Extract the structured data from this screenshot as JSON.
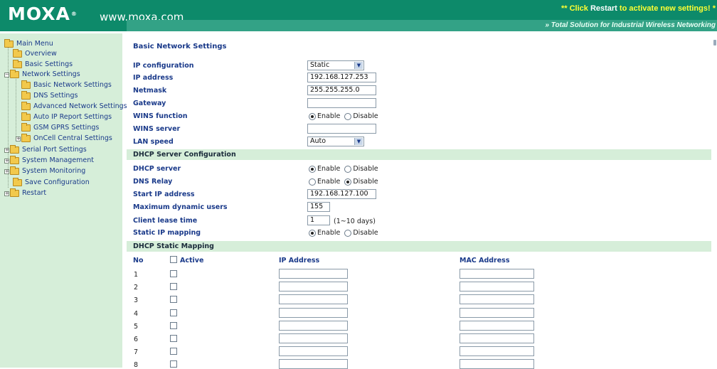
{
  "header": {
    "logo": "MOXA",
    "logo_mark": "®",
    "url": "www.moxa.com",
    "notice_prefix": "** Click ",
    "notice_bold": "Restart",
    "notice_suffix": " to activate new settings! *",
    "tagline": "» Total Solution for Industrial Wireless Networking",
    "bg_color": "#0d8a6a",
    "notice_color": "#ffff33"
  },
  "sidebar": {
    "items": [
      {
        "label": "Main Menu",
        "toggle": ""
      },
      {
        "label": "Overview",
        "toggle": ""
      },
      {
        "label": "Basic Settings",
        "toggle": ""
      },
      {
        "label": "Network Settings",
        "toggle": "−"
      },
      {
        "label": "Basic Network Settings",
        "toggle": ""
      },
      {
        "label": "DNS Settings",
        "toggle": ""
      },
      {
        "label": "Advanced Network Settings",
        "toggle": ""
      },
      {
        "label": "Auto IP Report Settings",
        "toggle": ""
      },
      {
        "label": "GSM GPRS Settings",
        "toggle": ""
      },
      {
        "label": "OnCell Central Settings",
        "toggle": "+"
      },
      {
        "label": "Serial Port Settings",
        "toggle": "+"
      },
      {
        "label": "System Management",
        "toggle": "+"
      },
      {
        "label": "System Monitoring",
        "toggle": "+"
      },
      {
        "label": "Save Configuration",
        "toggle": ""
      },
      {
        "label": "Restart",
        "toggle": "+"
      }
    ],
    "bg_color": "#d6eed9"
  },
  "page": {
    "title": "Basic Network Settings"
  },
  "basic": {
    "ip_config_label": "IP configuration",
    "ip_config_value": "Static",
    "ip_address_label": "IP address",
    "ip_address_value": "192.168.127.253",
    "netmask_label": "Netmask",
    "netmask_value": "255.255.255.0",
    "gateway_label": "Gateway",
    "gateway_value": "",
    "wins_function_label": "WINS function",
    "wins_server_label": "WINS server",
    "wins_server_value": "",
    "lan_speed_label": "LAN speed",
    "lan_speed_value": "Auto",
    "enable": "Enable",
    "disable": "Disable"
  },
  "dhcp": {
    "section_title": "DHCP Server Configuration",
    "server_label": "DHCP server",
    "dns_relay_label": "DNS Relay",
    "start_ip_label": "Start IP address",
    "start_ip_value": "192.168.127.100",
    "max_users_label": "Maximum dynamic users",
    "max_users_value": "155",
    "lease_label": "Client lease time",
    "lease_value": "1",
    "lease_hint": "(1~10 days)",
    "static_map_label": "Static IP mapping"
  },
  "mapping": {
    "section_title": "DHCP Static Mapping",
    "col_no": "No",
    "col_active": "Active",
    "col_ip": "IP Address",
    "col_mac": "MAC Address",
    "rows": [
      "1",
      "2",
      "3",
      "4",
      "5",
      "6",
      "7",
      "8"
    ]
  },
  "icons": {
    "folder": "folder-icon",
    "expand": "plus-icon",
    "collapse": "minus-icon"
  }
}
